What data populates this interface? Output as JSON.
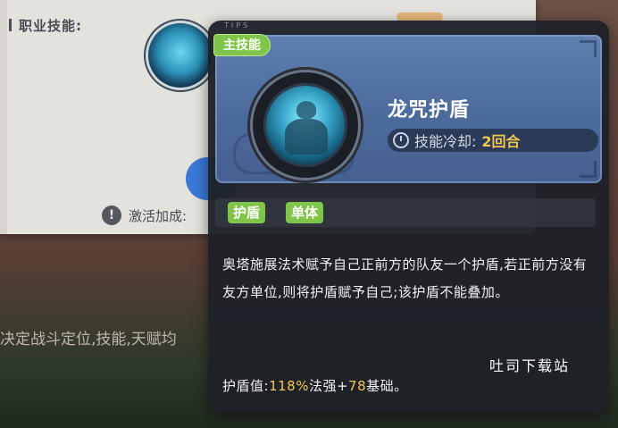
{
  "background": {
    "section_title": "职业技能:",
    "hint_text": "激活加成:",
    "hint_icon": "!",
    "bottom_text": "决定战斗定位,技能,天赋均"
  },
  "tooltip": {
    "tips_label": "TIPS",
    "badge": "主技能",
    "skill_name": "龙咒护盾",
    "cooldown_label": "技能冷却:",
    "cooldown_value": "2回合",
    "tags": [
      "护盾",
      "单体"
    ],
    "description": "奥塔施展法术赋予自己正前方的队友一个护盾,若正前方没有友方单位,则将护盾赋予自己;该护盾不能叠加。",
    "stat": {
      "label": "护盾值:",
      "percent": "118%",
      "mid": "法强+",
      "base": "78",
      "suffix": "基础。"
    }
  },
  "watermark": "吐司下载站",
  "colors": {
    "tag_green": "#7fc54a",
    "highlight_gold": "#f3c64e",
    "header_blue": "#4c6a9c",
    "card_bg": "#1e2128"
  }
}
